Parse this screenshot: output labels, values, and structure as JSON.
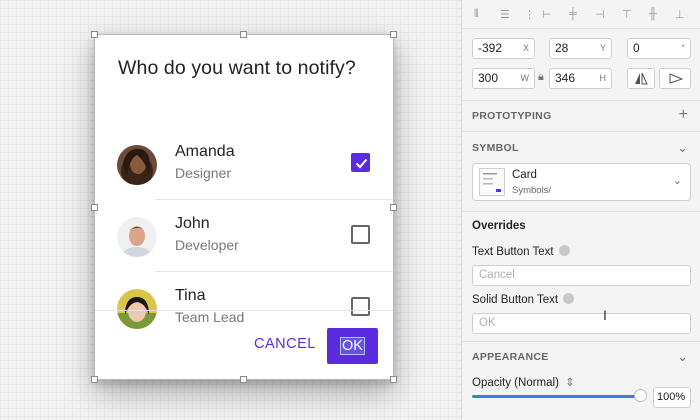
{
  "dialog": {
    "title": "Who do you want to notify?",
    "people": [
      {
        "name": "Amanda",
        "role": "Designer",
        "checked": true
      },
      {
        "name": "John",
        "role": "Developer",
        "checked": false
      },
      {
        "name": "Tina",
        "role": "Team Lead",
        "checked": false
      }
    ],
    "cancel_label": "CANCEL",
    "ok_label": "OK",
    "accent": "#5b2be0"
  },
  "inspector": {
    "x_value": "-392",
    "x_suffix": "X",
    "y_value": "28",
    "y_suffix": "Y",
    "rotation_value": "0",
    "rotation_suffix": "°",
    "w_value": "300",
    "w_suffix": "W",
    "h_value": "346",
    "h_suffix": "H",
    "prototyping_heading": "PROTOTYPING",
    "symbol_heading": "SYMBOL",
    "symbol_name": "Card",
    "symbol_path": "Symbols/",
    "overrides_heading": "Overrides",
    "text_button_label": "Text Button Text",
    "text_button_placeholder": "Cancel",
    "solid_button_label": "Solid Button Text",
    "solid_button_placeholder": "OK",
    "appearance_heading": "APPEARANCE",
    "opacity_label": "Opacity (Normal)",
    "opacity_value": "100%",
    "opacity_level": 1.0
  }
}
